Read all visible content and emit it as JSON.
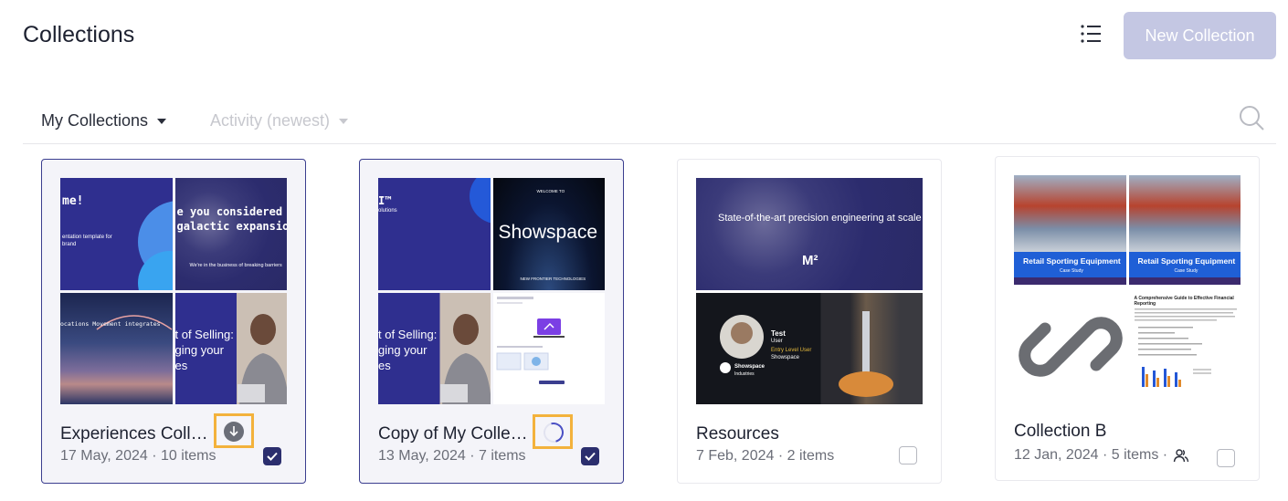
{
  "header": {
    "title": "Collections",
    "new_collection_label": "New Collection"
  },
  "filters": {
    "owner": "My Collections",
    "sort": "Activity (newest)"
  },
  "icons": {
    "list_view": "list-icon",
    "search": "search-icon",
    "download": "download-icon",
    "loading": "spinner-icon",
    "shared": "users-icon",
    "link": "link-icon"
  },
  "colors": {
    "accent": "#2b2e6e",
    "button_disabled": "#c4c7e3",
    "highlight": "#f3b23c"
  },
  "collections": [
    {
      "name": "Experiences Collec...",
      "meta": "17 May, 2024 · 10 items",
      "selected": true,
      "status": "download",
      "thumbs": {
        "t1": "me!",
        "t1b": "entation template for",
        "t1c": "brand",
        "t2": "e you considered",
        "t2b": "galactic expansion",
        "t2c": "We're in the business of breaking barriers",
        "t3": "ocations Movement integrates",
        "t4a": "t of Selling:",
        "t4b": "ging your",
        "t4c": "es"
      }
    },
    {
      "name": "Copy of My Collect...",
      "meta": "13 May, 2024 · 7 items",
      "selected": true,
      "status": "loading",
      "thumbs": {
        "t1": "I™",
        "t1b": "olutions",
        "t2top": "WELCOME TO",
        "t2": "Showspace",
        "t2c": "NEW FRONTIER TECHNOLOGIES",
        "t3a": "t of Selling:",
        "t3b": "ging your",
        "t3c": "es"
      }
    },
    {
      "name": "Resources",
      "meta": "7 Feb, 2024 · 2 items",
      "selected": false,
      "thumbs": {
        "t1": "State-of-the-art precision engineering at scale",
        "t1b": "M²",
        "t2a": "Test",
        "t2b": "User",
        "t2c": "Entry Level User",
        "t2d": "Showspace",
        "t2e": "Showspace",
        "t2f": "Industries"
      }
    },
    {
      "name": "Collection B",
      "meta": "12 Jan, 2024 · 5 items ·",
      "selected": false,
      "thumbs": {
        "t1": "Retail Sporting Equipment",
        "t1b": "Case Study",
        "t2": "Retail Sporting Equipment",
        "t2b": "Case Study",
        "doc_title": "A Comprehensive Guide to Effective Financial Reporting"
      }
    }
  ]
}
